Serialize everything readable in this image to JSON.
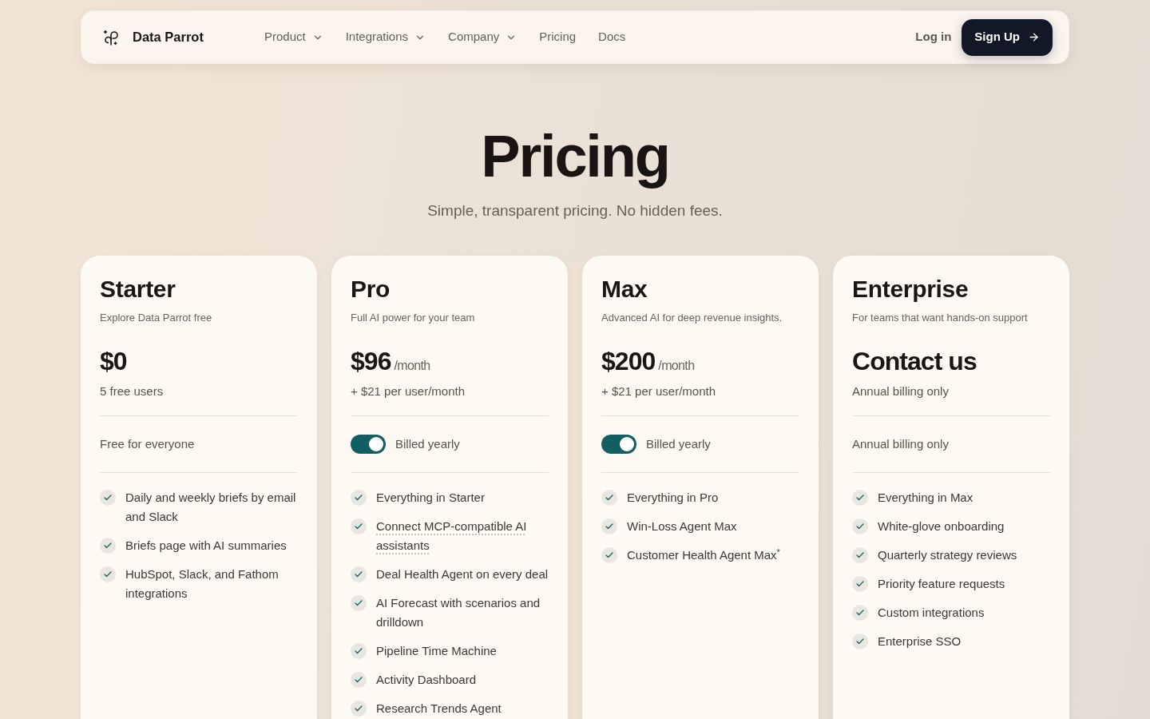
{
  "nav": {
    "brand": "Data Parrot",
    "links": [
      {
        "label": "Product",
        "dropdown": true
      },
      {
        "label": "Integrations",
        "dropdown": true
      },
      {
        "label": "Company",
        "dropdown": true
      },
      {
        "label": "Pricing",
        "dropdown": false
      },
      {
        "label": "Docs",
        "dropdown": false
      }
    ],
    "login": "Log in",
    "signup": "Sign Up"
  },
  "hero": {
    "title": "Pricing",
    "subtitle": "Simple, transparent pricing. No hidden fees."
  },
  "plans": [
    {
      "name": "Starter",
      "description": "Explore Data Parrot free",
      "price": "$0",
      "note": "5 free users",
      "billing": {
        "kind": "text",
        "label": "Free for everyone"
      },
      "features": [
        {
          "kind": "plain",
          "text": "Daily and weekly briefs by email and Slack"
        },
        {
          "kind": "plain",
          "text": "Briefs page with AI summaries"
        },
        {
          "kind": "plain",
          "text": "HubSpot, Slack, and Fathom integrations"
        }
      ]
    },
    {
      "name": "Pro",
      "description": "Full AI power for your team",
      "price": "$96",
      "period": "/month",
      "note": "+ $21 per user/month",
      "billing": {
        "kind": "toggle",
        "on": true,
        "label": "Billed yearly"
      },
      "features": [
        {
          "kind": "plain",
          "text": "Everything in Starter"
        },
        {
          "kind": "tooltip",
          "text": "Connect MCP-compatible AI assistants"
        },
        {
          "kind": "plain",
          "text": "Deal Health Agent on every deal"
        },
        {
          "kind": "plain",
          "text": "AI Forecast with scenarios and drilldown"
        },
        {
          "kind": "plain",
          "text": "Pipeline Time Machine"
        },
        {
          "kind": "plain",
          "text": "Activity Dashboard"
        },
        {
          "kind": "plain",
          "text": "Research Trends Agent"
        }
      ]
    },
    {
      "name": "Max",
      "description": "Advanced AI for deep revenue insights.",
      "price": "$200",
      "period": "/month",
      "note": "+ $21 per user/month",
      "billing": {
        "kind": "toggle",
        "on": true,
        "label": "Billed yearly"
      },
      "features": [
        {
          "kind": "plain",
          "text": "Everything in Pro"
        },
        {
          "kind": "plain",
          "text": "Win-Loss Agent Max"
        },
        {
          "kind": "plain",
          "text": "Customer Health Agent Max$^{*}$"
        }
      ]
    },
    {
      "name": "Enterprise",
      "description": "For teams that want hands-on support",
      "price": "Contact us",
      "note": "Annual billing only",
      "billing": {
        "kind": "text",
        "label": "Annual billing only"
      },
      "features": [
        {
          "kind": "plain",
          "text": "Everything in Max"
        },
        {
          "kind": "plain",
          "text": "White-glove onboarding"
        },
        {
          "kind": "plain",
          "text": "Quarterly strategy reviews"
        },
        {
          "kind": "plain",
          "text": "Priority feature requests"
        },
        {
          "kind": "plain",
          "text": "Custom integrations"
        },
        {
          "kind": "plain",
          "text": "Enterprise SSO"
        }
      ]
    }
  ]
}
